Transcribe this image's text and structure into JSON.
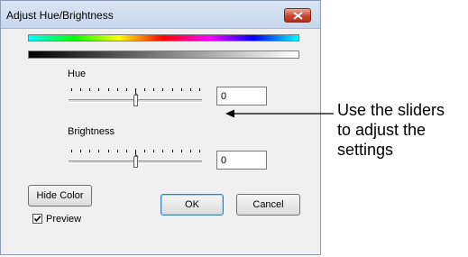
{
  "window": {
    "title": "Adjust Hue/Brightness"
  },
  "hue": {
    "label": "Hue",
    "value": "0",
    "level": 0.5
  },
  "brightness": {
    "label": "Brightness",
    "value": "0",
    "level": 0.5
  },
  "buttons": {
    "hide_color": "Hide Color",
    "ok": "OK",
    "cancel": "Cancel"
  },
  "preview": {
    "label": "Preview",
    "checked": true
  },
  "annotation": {
    "text_lines": [
      "Use the sliders",
      "to adjust the",
      "settings"
    ]
  },
  "colors": {
    "title_bar": "#c6d6ec",
    "dialog_bg": "#f0f0f0",
    "close_button": "#c7462f"
  },
  "icons": [
    "close-icon",
    "checkmark-icon",
    "arrow-icon"
  ]
}
